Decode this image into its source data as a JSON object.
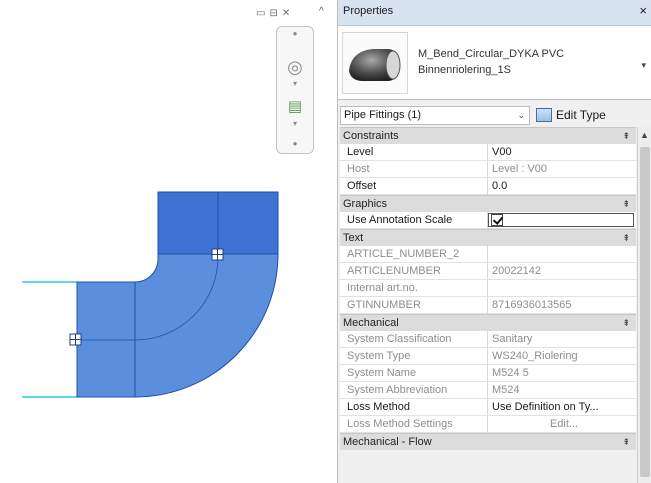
{
  "colors": {
    "pipe_fill": "#5b8fde",
    "pipe_top": "#3d73d2",
    "pipe_edge": "#1f4fa8",
    "connector_line": "#5fd8e8",
    "section_bg": "#dcdcdc"
  },
  "canvas": {
    "window_controls": {
      "minimize": "▭",
      "restore": "⊟",
      "close": "✕"
    },
    "scroll_arrow": "^",
    "nav_icons": {
      "wheel": "steering-wheel-icon",
      "zoom": "zoom-region-icon"
    }
  },
  "properties": {
    "title": "Properties",
    "close": "×",
    "type_name_line1": "M_Bend_Circular_DYKA PVC",
    "type_name_line2": "Binnenriolering_1S",
    "type_dropdown": "▾",
    "filter": "Pipe Fittings (1)",
    "filter_caret": "⌄",
    "edit_type": "Edit Type",
    "sections": {
      "constraints": "Constraints",
      "graphics": "Graphics",
      "text": "Text",
      "mechanical": "Mechanical",
      "mechanical_flow": "Mechanical - Flow"
    },
    "collapse": "⇞",
    "rows": {
      "level": {
        "name": "Level",
        "value": "V00"
      },
      "host": {
        "name": "Host",
        "value": "Level : V00"
      },
      "offset": {
        "name": "Offset",
        "value": "0.0"
      },
      "use_annotation_scale": {
        "name": "Use Annotation Scale",
        "checked": true
      },
      "article_number_2": {
        "name": "ARTICLE_NUMBER_2",
        "value": ""
      },
      "articlenumber": {
        "name": "ARTICLENUMBER",
        "value": "20022142"
      },
      "internal_art_no": {
        "name": "Internal art.no.",
        "value": ""
      },
      "gtinnumber": {
        "name": "GTINNUMBER",
        "value": "8716936013565"
      },
      "system_classification": {
        "name": "System Classification",
        "value": "Sanitary"
      },
      "system_type": {
        "name": "System Type",
        "value": "WS240_Riolering"
      },
      "system_name": {
        "name": "System Name",
        "value": "M524 5"
      },
      "system_abbreviation": {
        "name": "System Abbreviation",
        "value": "M524"
      },
      "loss_method": {
        "name": "Loss Method",
        "value": "Use Definition on Ty..."
      },
      "loss_method_settings": {
        "name": "Loss Method Settings",
        "value": "Edit..."
      }
    }
  }
}
